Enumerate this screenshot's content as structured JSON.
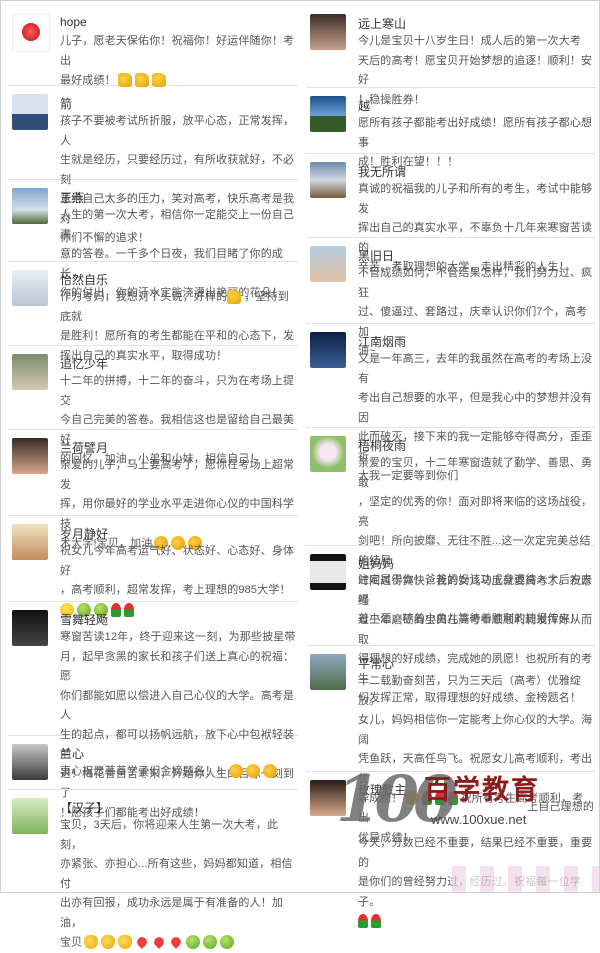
{
  "left_posts": [
    {
      "name": "hope",
      "avatar": "red-rose-icon",
      "lines": [
        "儿子，愿老天保佑你！祝福你！好运伴随你！考出",
        "最好成绩！"
      ],
      "emojis": [
        "thumb",
        "thumb",
        "thumb"
      ]
    },
    {
      "name": "箭",
      "avatar": "landscape-photo",
      "lines": [
        "孩子不要被考试所折服，放平心态，正常发挥，人",
        "生就是经历，只要经历过，有所收获就好，不必刻",
        "意给自己太多的压力，笑对高考，快乐高考是我对",
        "你们不懈的追求！"
      ],
      "emojis": []
    },
    {
      "name": "王燕",
      "avatar": "landscape-photo",
      "lines": [
        "人生的第一次大考，相信你一定能交上一份自己满",
        "意的答卷。一千多个日夜，我们目睹了你的成长，",
        "你的付出，你的汗水定能浇灌出艳丽的花朵！"
      ],
      "emojis": []
    },
    {
      "name": "怡然自乐",
      "avatar": "girl-photo",
      "lines": [
        "作为考妈，我想对丫头说，好样的",
        "是胜利！愿所有的考生都能在平和的心态下，发",
        "挥出自己的真实水平，取得成功！"
      ],
      "inline_after": "，坚持到底就",
      "emojis": [
        "thumb"
      ]
    },
    {
      "name": "追忆少年",
      "avatar": "boy-photo",
      "lines": [
        "十二年的拼搏，十二年的奋斗，只为在考场上提交",
        "今自己完美的答卷。我相信这也是留给自己最美好",
        "的回忆。加油，小弟和小妹，相信自己！"
      ],
      "emojis": []
    },
    {
      "name": "兰荷譬月",
      "avatar": "woman-photo",
      "lines": [
        "亲爱的儿子，马上要高考了，愿你在考场上超常发",
        "挥，用你最好的学业水平走进你心仪的中国科学技",
        "术大学!宝贝，加油"
      ],
      "emojis": [
        "fist",
        "fist",
        "fist"
      ]
    },
    {
      "name": "岁月静好",
      "avatar": "woman-photo",
      "lines": [
        "祝女儿今年高考运气好、状态好、心态好、身体好",
        "，高考顺利，超常发挥，考上理想的985大学！"
      ],
      "emojis": [
        "smile",
        "green",
        "green",
        "rose",
        "rose"
      ]
    },
    {
      "name": "雪舞轻飏",
      "avatar": "dark-photo",
      "lines": [
        "寒窗苦读12年，终于迎来这一刻，为那些披星带",
        "月，起早贪黑的家长和孩子们送上真心的祝福：愿",
        "你们都能如愿以偿进入自己心仪的大学。高考是人",
        "生的起点，都可以扬帆远航，放下心中包袱轻装前",
        "进！梅花香自苦寒来，开始你人生的目标一刻到了",
        "！愿孩子们都能考出好成绩！"
      ],
      "emojis": []
    },
    {
      "name": "兰心",
      "avatar": "dark-photo",
      "lines": [
        "衷心祝愿莘莘学子们金榜题名！！"
      ],
      "emojis": [
        "fist",
        "fist",
        "fist"
      ]
    },
    {
      "name": "【汉子】",
      "avatar": "green-photo",
      "lines": [
        "宝贝，3天后，你将迎来人生第一次大考，此刻，",
        "亦紧张、亦担心...所有这些，妈妈都知道，相信付",
        "出亦有回报，成功永远是属于有准备的人！加油，",
        "宝贝"
      ],
      "emojis": [
        "victory",
        "victory",
        "victory",
        "heart",
        "heart",
        "heart",
        "green",
        "green",
        "green"
      ]
    }
  ],
  "right_posts": [
    {
      "name": "远上寒山",
      "avatar": "girl-photo",
      "lines": [
        "今儿是宝贝十八岁生日！成人后的第一次大考",
        "天后的高考！愿宝贝开始梦想的追逐！顺利！安好",
        "！稳操胜券！"
      ],
      "emojis": []
    },
    {
      "name": "越",
      "avatar": "landscape-photo",
      "lines": [
        "愿所有孩子都能考出好成绩！愿所有孩子都心想事",
        "成！胜利在望！！！"
      ],
      "emojis": []
    },
    {
      "name": "我无所谓",
      "avatar": "landscape-photo",
      "lines": [
        "真诚的祝福我的儿子和所有的考生，考试中能够发",
        "挥出自己的真实水平，不辜负十几年来寒窗苦读的",
        "辛苦。考取理想的大学，走出精彩的人生！"
      ],
      "emojis": []
    },
    {
      "name": "黑旧日_",
      "avatar": "boy-photo",
      "lines": [
        "不管成绩如何，不管结果怎样，我们努力过、疯狂",
        "过、傻逼过、套路过，庆幸认识你们7个，高考加",
        "油~"
      ],
      "emojis": []
    },
    {
      "name": "江南烟雨",
      "avatar": "landscape-photo",
      "lines": [
        "又是一年高三，去年的我虽然在高考的考场上没有",
        "考出自己想要的水平，但是我心中的梦想并没有因",
        "此而破灭，接下来的我一定能够夺得高分，歪歪祈",
        "大我一定要等到你们"
      ],
      "emojis": []
    },
    {
      "name": "梧桐夜雨",
      "avatar": "flower-photo",
      "lines": [
        "亲爱的宝贝，十二年寒窗造就了勤学、善思、勇敢",
        "，坚定的优秀的你！面对即将来临的这场战役，亮",
        "剑吧！所向披靡、无往不胜...这一次定完美总结的结局",
        "注定属于你！爸爸妈妈该功成身退待入大后方去喝",
        "着小酒，哼着小曲儿等待着胜利的捷报传来！"
      ],
      "emojis": []
    },
    {
      "name": "姐妈妈",
      "avatar": "landscape-photo",
      "lines": [
        "时间过得真快，我的女儿马上就要高考了。祝愿经",
        "过三年磨砺的宝贝在高考中顺顺利利发挥好从而取",
        "得理想的好成绩，完成她的夙愿！也祝所有的考生",
        "们发挥正常，取得理想的好成绩、金榜题名！"
      ],
      "emojis": []
    },
    {
      "name": "平常心",
      "avatar": "landscape-photo",
      "lines": [
        "十二载勤奋刻苦，只为三天后（高考）优雅绽放。",
        "女儿，妈妈相信你一定能考上你心仪的大学。海阔",
        "凭鱼跃，天高任鸟飞。祝愿女儿高考顺利，考出优",
        "异成绩！"
      ],
      "inline_after": "祝所有考生高考顺利，考出",
      "extra_line": "优异成绩！",
      "emojis": [
        "fist",
        "rose",
        "rose",
        "rose"
      ]
    },
    {
      "name": "玫瑰教主",
      "avatar": "woman-photo",
      "lines": [
        "",
        "上自己理想的"
      ],
      "emojis": []
    },
    {
      "name": "",
      "avatar": "none",
      "lines": [
        "今天，分数已经不重要，结果已经不重要，重要的",
        "是你们的曾经努力过，经历过。祝福每一位学子。"
      ],
      "emojis": [
        "rose",
        "rose"
      ]
    }
  ],
  "watermark": {
    "number": "100",
    "chinese": "百学教育",
    "url": "www.100xue.net"
  }
}
